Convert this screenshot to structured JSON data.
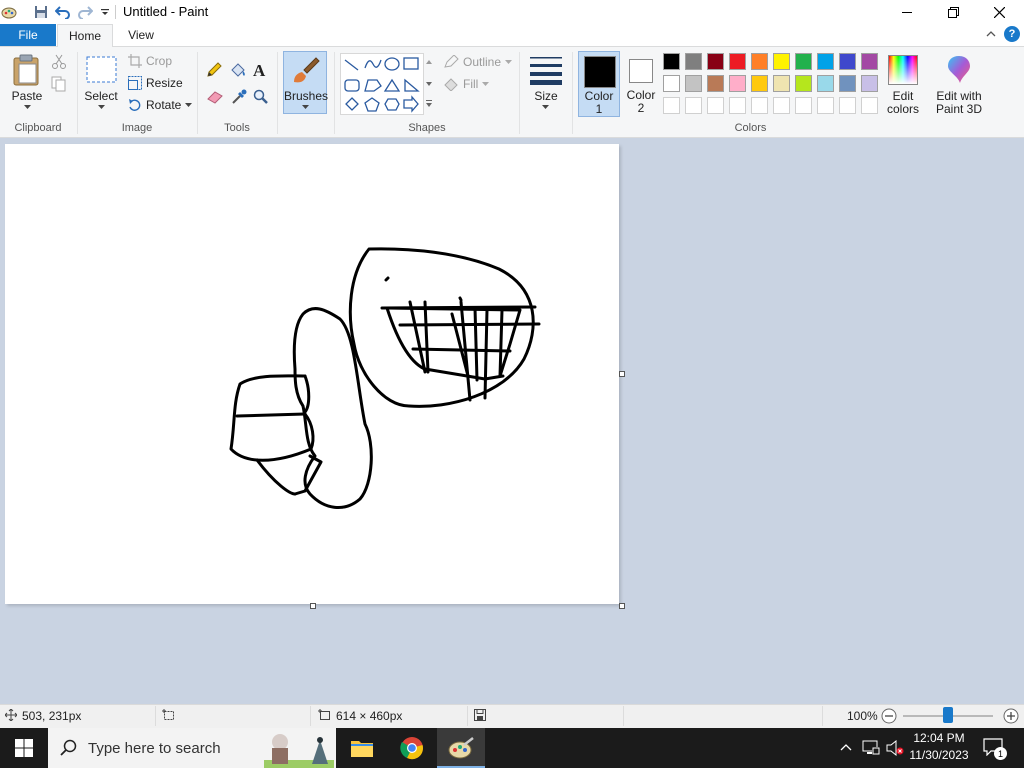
{
  "window": {
    "title": "Untitled - Paint"
  },
  "tabs": {
    "file": "File",
    "home": "Home",
    "view": "View"
  },
  "clipboard": {
    "paste": "Paste",
    "group": "Clipboard"
  },
  "image": {
    "select": "Select",
    "crop": "Crop",
    "resize": "Resize",
    "rotate": "Rotate",
    "group": "Image"
  },
  "tools": {
    "group": "Tools"
  },
  "brushes": {
    "label": "Brushes"
  },
  "shapes": {
    "outline": "Outline",
    "fill": "Fill",
    "group": "Shapes"
  },
  "size": {
    "label": "Size"
  },
  "colors": {
    "color1_line1": "Color",
    "color1_line2": "1",
    "color2_line1": "Color",
    "color2_line2": "2",
    "color1_value": "#000000",
    "color2_value": "#ffffff",
    "edit_line1": "Edit",
    "edit_line2": "colors",
    "paint3d_line1": "Edit with",
    "paint3d_line2": "Paint 3D",
    "group": "Colors",
    "row1": [
      "#000000",
      "#7f7f7f",
      "#880015",
      "#ed1c24",
      "#ff7f27",
      "#fff200",
      "#22b14c",
      "#00a2e8",
      "#3f48cc",
      "#a349a4"
    ],
    "row2": [
      "#ffffff",
      "#c3c3c3",
      "#b97a57",
      "#ffaec9",
      "#ffc90e",
      "#efe4b0",
      "#b5e61d",
      "#99d9ea",
      "#7092be",
      "#c8bfe7"
    ]
  },
  "status": {
    "cursor": "503, 231px",
    "canvas_size": "614 × 460px",
    "zoom": "100%",
    "zoom_fraction": 0.5
  },
  "taskbar": {
    "search_placeholder": "Type here to search",
    "time": "12:04 PM",
    "date": "11/30/2023",
    "notifications": "1"
  }
}
